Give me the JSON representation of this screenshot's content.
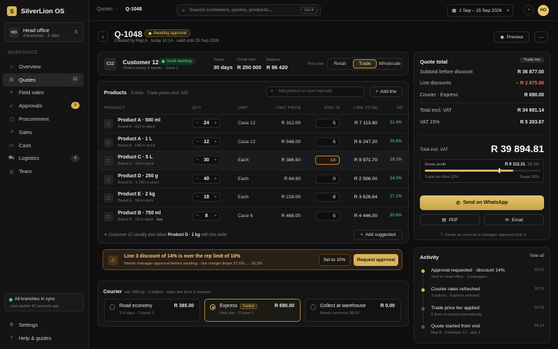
{
  "app": {
    "name": "SilverLion OS",
    "logo_glyph": "S"
  },
  "org": {
    "initials": "HO",
    "name": "Head office",
    "sub": "4 branches · 3 sites"
  },
  "sidebar": {
    "section_label": "WORKSPACE",
    "items": [
      {
        "label": "Overview",
        "icon": "overview-icon",
        "glyph": "⌂"
      },
      {
        "label": "Quotes",
        "icon": "quotes-icon",
        "glyph": "▤",
        "badge": "12",
        "active": true
      },
      {
        "label": "Field sales",
        "icon": "map-pin-icon",
        "glyph": "⌖"
      },
      {
        "label": "Approvals",
        "icon": "check-circle-icon",
        "glyph": "✓",
        "badge": "6",
        "badge_style": "gold"
      },
      {
        "label": "Procurement",
        "icon": "box-icon",
        "glyph": "▢"
      },
      {
        "label": "Sales",
        "icon": "trend-icon",
        "glyph": "↗"
      },
      {
        "label": "Cash",
        "icon": "cash-icon",
        "glyph": "▭"
      },
      {
        "label": "Logistics",
        "icon": "truck-icon",
        "glyph": "⛟",
        "badge": "4"
      },
      {
        "label": "Team",
        "icon": "team-icon",
        "glyph": "◎"
      }
    ],
    "sync": {
      "title": "All branches in sync",
      "sub": "Last update 42 seconds ago"
    },
    "footer": [
      {
        "label": "Settings",
        "icon": "gear-icon",
        "glyph": "⚙"
      },
      {
        "label": "Help & guides",
        "icon": "help-icon",
        "glyph": "?"
      }
    ]
  },
  "topbar": {
    "crumb_parent": "Quotes",
    "crumb_current": "Q-1048",
    "search_placeholder": "Search customers, quotes, products...",
    "search_shortcut": "Ctrl K",
    "date_range": "1 Sep – 15 Sep 2026",
    "user_initials": "HO"
  },
  "quote": {
    "id": "Q-1048",
    "status": "Awaiting approval",
    "meta": "Created by Rep A · today 10:14 · valid until 29 Sep 2026",
    "preview_label": "Preview"
  },
  "customer": {
    "initials": "C12",
    "name": "Customer 12",
    "standing": "Good standing",
    "sub": "Orders every 3 weeks · Zone 3",
    "terms_label": "Terms",
    "terms_value": "30 days",
    "credit_label": "Credit limit",
    "credit_value": "R 250 000",
    "balance_label": "Balance",
    "balance_value": "R 86 420",
    "tier_label": "Price tier",
    "tiers": [
      "Retail",
      "Trade",
      "Wholesale"
    ],
    "tier_selected": "Trade"
  },
  "products": {
    "title": "Products",
    "meta": "· 6 lines · Trade prices excl. VAT",
    "search_placeholder": "Add product or scan barcode",
    "add_line_label": "Add line",
    "columns": [
      "PRODUCT",
      "QTY",
      "UNIT",
      "UNIT PRICE",
      "DISC %",
      "LINE TOTAL",
      "GP"
    ],
    "rows": [
      {
        "name": "Product A · 500 ml",
        "sub": "Brand A · 412 in stock",
        "low": "",
        "qty": "24",
        "unit": "Case 12",
        "price": "R 312.00",
        "disc": "5",
        "total": "R 7 113.60",
        "gp": "31.4%",
        "gp_color": "#5ed08b"
      },
      {
        "name": "Product A · 1 L",
        "sub": "Brand A · 188 in stock",
        "low": "",
        "qty": "12",
        "unit": "Case 12",
        "price": "R 548.00",
        "disc": "5",
        "total": "R 6 247.20",
        "gp": "29.8%",
        "gp_color": "#5ed08b"
      },
      {
        "name": "Product C · 5 L",
        "sub": "Brand C · 64 in stock",
        "low": "",
        "qty": "30",
        "unit": "Each",
        "price": "R 386.50",
        "disc": "14",
        "warn": true,
        "total": "R 9 971.70",
        "gp": "18.2%",
        "gp_color": "#e6a85a"
      },
      {
        "name": "Product D · 250 g",
        "sub": "Brand D · 1 240 in stock",
        "low": "",
        "qty": "40",
        "unit": "Each",
        "price": "R 64.90",
        "disc": "0",
        "total": "R 2 596.00",
        "gp": "34.0%",
        "gp_color": "#5ed08b"
      },
      {
        "name": "Product E · 2 kg",
        "sub": "Brand E · 96 in stock",
        "low": "",
        "qty": "18",
        "unit": "Each",
        "price": "R 219.00",
        "disc": "8",
        "total": "R 3 626.64",
        "gp": "27.1%",
        "gp_color": "#5ed08b"
      },
      {
        "name": "Product B · 750 ml",
        "sub": "Brand B · 22 in stock · ",
        "low": "low",
        "qty": "8",
        "unit": "Case 6",
        "price": "R 468.00",
        "disc": "5",
        "total": "R 4 446.00",
        "gp": "30.6%",
        "gp_color": "#5ed08b"
      }
    ],
    "upsell_pre": "Customer 12 usually also takes ",
    "upsell_product": "Product D · 1 kg",
    "upsell_post": " with this order",
    "add_suggested_label": "Add suggested"
  },
  "alert": {
    "title": "Line 3 discount of 14% is over the rep limit of 10%",
    "sub": "Needs manager approval before sending · line margin drops 27.6% → 18.2%",
    "set_label": "Set to 10%",
    "request_label": "Request approval"
  },
  "courier": {
    "title": "Courier",
    "meta": "est. 486 kg · 2 pallets · rates live from 3 couriers",
    "options": [
      {
        "name": "Road economy",
        "sub": "3–5 days · Courier 2",
        "price": "R 385.00",
        "tag": ""
      },
      {
        "name": "Express",
        "sub": "Next day · Courier 1",
        "price": "R 690.00",
        "tag": "Fastest",
        "selected": true
      },
      {
        "name": "Collect at warehouse",
        "sub": "Ready tomorrow 08:00",
        "price": "R 0.00",
        "tag": ""
      }
    ]
  },
  "totals": {
    "title": "Quote total",
    "tier_tag": "Trade tier",
    "lines": [
      {
        "k": "Subtotal before discount",
        "v": "R 36 877.00"
      },
      {
        "k": "Line discounts",
        "v": "– R 2 875.86",
        "red": true
      },
      {
        "k": "Courier · Express",
        "v": "R 690.00"
      },
      {
        "k": "Total excl. VAT",
        "v": "R 34 691.14"
      },
      {
        "k": "VAT 15%",
        "v": "R 5 203.67"
      }
    ],
    "total_label": "Total incl. VAT",
    "total_value": "R 39 894.81",
    "gp_label": "Gross profit",
    "gp_value": "R 9 112.31",
    "gp_pct": "26.3%",
    "gp_fraction": 0.263,
    "gp_floor_fraction": 0.22,
    "gp_target_fraction": 0.3,
    "floor_label": "Trade tier floor 22%",
    "target_label": "Target 30%",
    "whatsapp_label": "Send on WhatsApp",
    "pdf_label": "PDF",
    "email_label": "Email",
    "note": "Sends as soon as a manager approves line 3"
  },
  "activity": {
    "title": "Activity",
    "view_all": "View all",
    "events": [
      {
        "a": "Approval requested · discount 14%",
        "b": "Sent to Head office · 2 managers",
        "t": "10:21",
        "c": "gold"
      },
      {
        "a": "Courier rates refreshed",
        "b": "3 options · Express selected",
        "t": "10:19",
        "c": "gold"
      },
      {
        "a": "Trade price tier applied",
        "b": "6 lines re-priced automatically",
        "t": "10:16",
        "c": "grey"
      },
      {
        "a": "Quote started from visit",
        "b": "Rep A · Customer 12 · stop 1",
        "t": "10:14",
        "c": "grey"
      }
    ]
  }
}
